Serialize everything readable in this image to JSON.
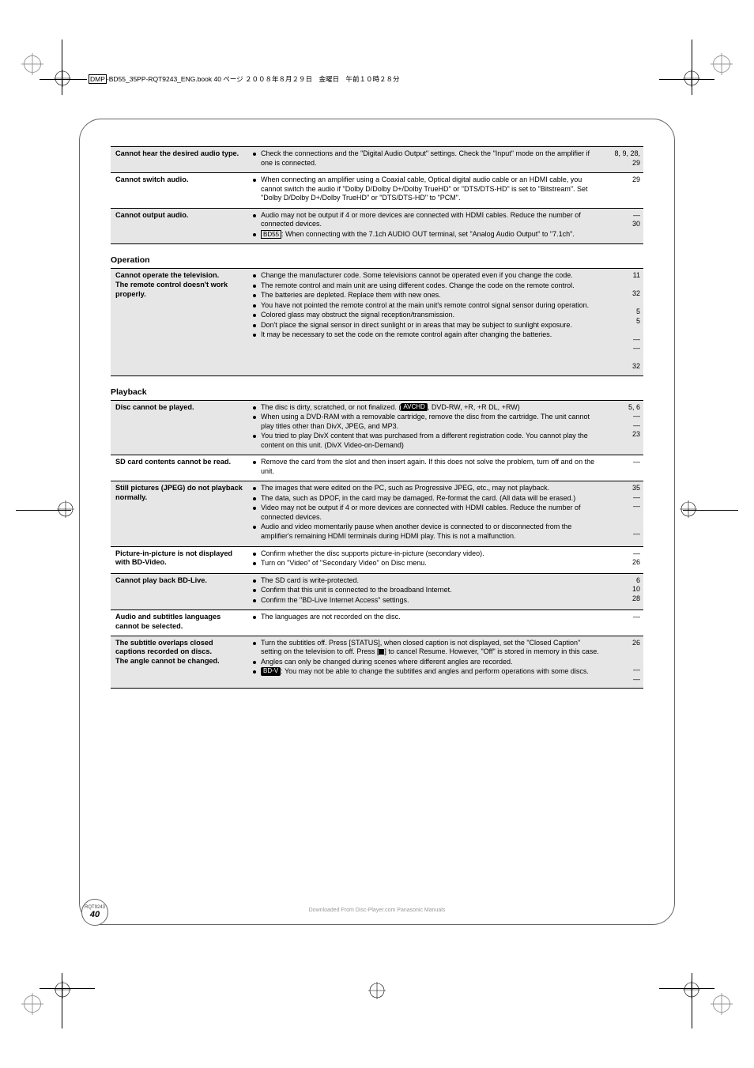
{
  "header": {
    "filename_boxed": "DMP",
    "filename_rest": "-BD55_35PP-RQT9243_ENG.book  40 ページ  ２００８年８月２９日　金曜日　午前１０時２８分"
  },
  "sections": [
    {
      "rows": [
        {
          "shade": true,
          "symptom": "Cannot hear the desired audio type.",
          "causes": [
            "Check the connections and the \"Digital Audio Output\" settings. Check the \"Input\" mode on the amplifier if one is connected."
          ],
          "ref": "8, 9, 28, 29"
        },
        {
          "shade": false,
          "symptom": "Cannot switch audio.",
          "causes": [
            "When connecting an amplifier using a Coaxial cable, Optical digital audio cable or an HDMI cable, you cannot switch the audio if \"Dolby D/Dolby D+/Dolby TrueHD\" or \"DTS/DTS-HD\" is set to \"Bitstream\". Set \"Dolby D/Dolby D+/Dolby TrueHD\" or \"DTS/DTS-HD\" to \"PCM\"."
          ],
          "ref": "29"
        },
        {
          "shade": true,
          "symptom": "Cannot output audio.",
          "causes": [
            "Audio may not be output if 4 or more devices are connected with HDMI cables. Reduce the number of connected devices.",
            "[BD55]: When connecting with the 7.1ch AUDIO OUT terminal, set \"Analog Audio Output\" to \"7.1ch\"."
          ],
          "ref": "—\n30"
        }
      ]
    },
    {
      "title": "Operation",
      "rows": [
        {
          "shade": true,
          "symptom": "Cannot operate the television.\nThe remote control doesn't work properly.",
          "causes": [
            "Change the manufacturer code. Some televisions cannot be operated even if you change the code.",
            "The remote control and main unit are using different codes. Change the code on the remote control.",
            "The batteries are depleted. Replace them with new ones.",
            "You have not pointed the remote control at the main unit's remote control signal sensor during operation.",
            "Colored glass may obstruct the signal reception/transmission.",
            "Don't place the signal sensor in direct sunlight or in areas that may be subject to sunlight exposure.",
            "It may be necessary to set the code on the remote control again after changing the batteries."
          ],
          "ref": "11\n\n32\n\n5\n5\n\n—\n—\n\n32"
        }
      ]
    },
    {
      "title": "Playback",
      "rows": [
        {
          "shade": true,
          "symptom": "Disc cannot be played.",
          "causes": [
            "The disc is dirty, scratched, or not finalized. ([AVCHD], DVD-RW, +R, +R DL, +RW)",
            "When using a DVD-RAM with a removable cartridge, remove the disc from the cartridge. The unit cannot play titles other than DivX, JPEG, and MP3.",
            "You tried to play DivX content that was purchased from a different registration code. You cannot play the content on this unit. (DivX Video-on-Demand)"
          ],
          "ref": "5, 6\n—\n—\n23"
        },
        {
          "shade": false,
          "symptom": "SD card contents cannot be read.",
          "causes": [
            "Remove the card from the slot and then insert again. If this does not solve the problem, turn off and on the unit."
          ],
          "ref": "—"
        },
        {
          "shade": true,
          "symptom": "Still pictures (JPEG) do not playback normally.",
          "causes": [
            "The images that were edited on the PC, such as Progressive JPEG, etc., may not playback.",
            "The data, such as DPOF, in the card may be damaged. Re-format the card. (All data will be erased.)",
            "Video may not be output if 4 or more devices are connected with HDMI cables. Reduce the number of connected devices.",
            "Audio and video momentarily pause when another device is connected to or disconnected from the amplifier's remaining HDMI terminals during HDMI play. This is not a malfunction."
          ],
          "ref": "35\n—\n—\n\n\n—"
        },
        {
          "shade": false,
          "symptom": "Picture-in-picture is not displayed with BD-Video.",
          "causes": [
            "Confirm whether the disc supports picture-in-picture (secondary video).",
            "Turn on \"Video\" of \"Secondary Video\" on Disc menu."
          ],
          "ref": "—\n26"
        },
        {
          "shade": true,
          "symptom": "Cannot play back BD-Live.",
          "causes": [
            "The SD card is write-protected.",
            "Confirm that this unit is connected to the broadband Internet.",
            "Confirm the \"BD-Live Internet Access\" settings."
          ],
          "ref": "6\n10\n28"
        },
        {
          "shade": false,
          "symptom": "Audio and subtitles languages cannot be selected.",
          "causes": [
            "The languages are not recorded on the disc."
          ],
          "ref": "—"
        },
        {
          "shade": true,
          "symptom": "The subtitle overlaps closed captions recorded on discs.\nThe angle cannot be changed.",
          "causes": [
            "Turn the subtitles off. Press [STATUS], when closed caption is not displayed, set the \"Closed Caption\" setting on the television to off. Press [■] to cancel Resume. However, \"Off\" is stored in memory in this case.",
            "Angles can only be changed during scenes where different angles are recorded.",
            "[BD-V]: You may not be able to change the subtitles and angles and perform operations with some discs."
          ],
          "ref": "26\n\n\n—\n—"
        }
      ]
    }
  ],
  "footer": {
    "rqt": "RQT9243",
    "page_big": "40",
    "copy": "Downloaded From Disc-Player.com Panasonic Manuals"
  },
  "badges": {
    "avchd": "AVCHD",
    "bdv": "BD-V"
  }
}
